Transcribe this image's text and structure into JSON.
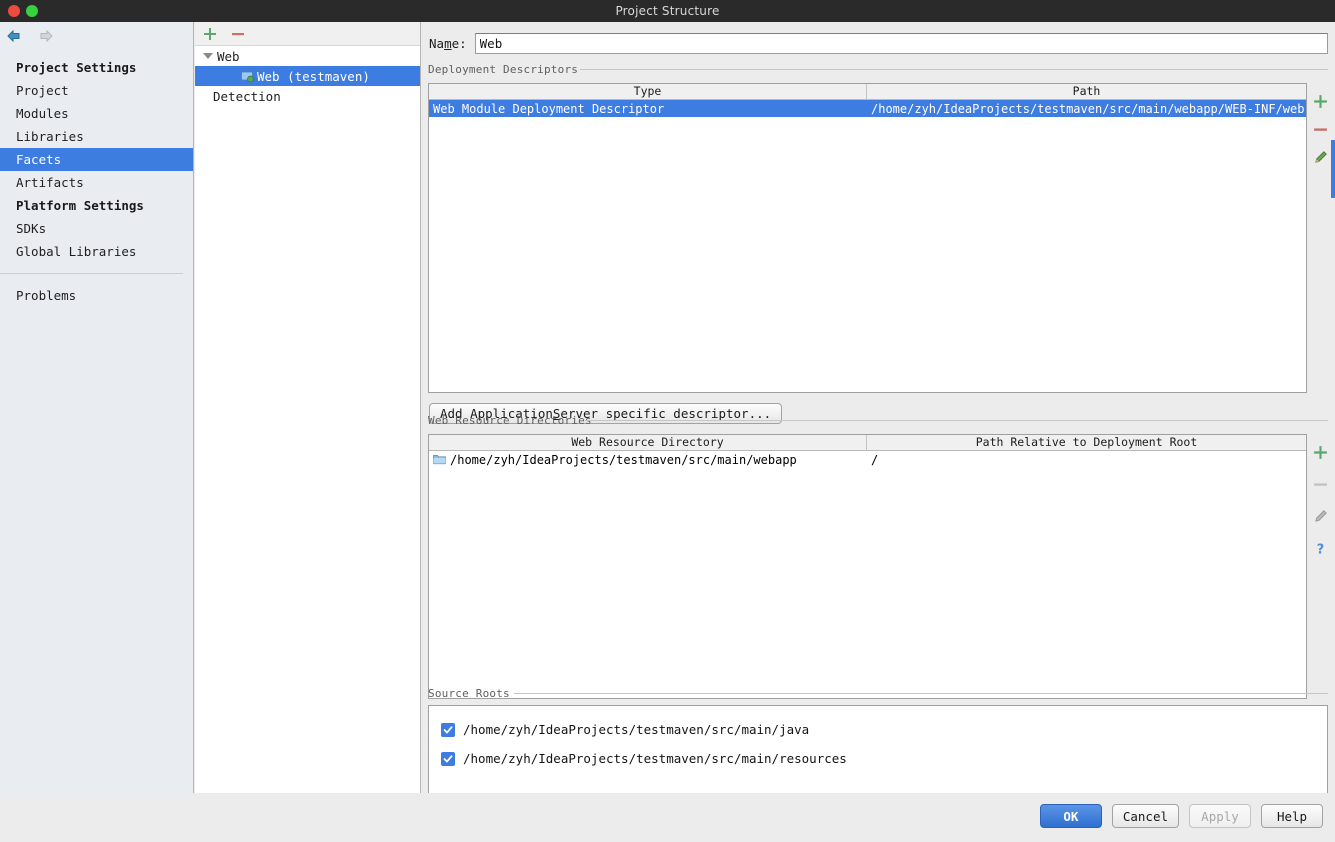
{
  "window": {
    "title": "Project Structure",
    "traffic_lights": [
      "close-red",
      "maximize-green"
    ]
  },
  "nav": {
    "back_icon": "arrow-left-icon",
    "forward_icon": "arrow-right-icon"
  },
  "sidebar": {
    "groups": [
      {
        "label": "Project Settings",
        "items": [
          {
            "label": "Project",
            "selected": false
          },
          {
            "label": "Modules",
            "selected": false
          },
          {
            "label": "Libraries",
            "selected": false
          },
          {
            "label": "Facets",
            "selected": true
          },
          {
            "label": "Artifacts",
            "selected": false
          }
        ]
      },
      {
        "label": "Platform Settings",
        "items": [
          {
            "label": "SDKs",
            "selected": false
          },
          {
            "label": "Global Libraries",
            "selected": false
          }
        ]
      }
    ],
    "footer_item": {
      "label": "Problems",
      "selected": false
    }
  },
  "tree": {
    "toolbar": {
      "add_label": "+",
      "remove_label": "–"
    },
    "nodes": [
      {
        "label": "Web",
        "type": "group",
        "expanded": true,
        "selected": false
      },
      {
        "label": "Web (testmaven)",
        "type": "facet",
        "selected": true
      },
      {
        "label": "Detection",
        "type": "group",
        "selected": false
      }
    ]
  },
  "main": {
    "name_field": {
      "label": "Name:",
      "label_mnemonic": "m",
      "value": "Web"
    },
    "deployment_descriptors": {
      "title": "Deployment Descriptors",
      "columns": [
        "Type",
        "Path"
      ],
      "rows": [
        {
          "type": "Web Module Deployment Descriptor",
          "path": "/home/zyh/IdeaProjects/testmaven/src/main/webapp/WEB-INF/web.xml",
          "selected": true
        }
      ],
      "tools": [
        {
          "name": "add-descriptor-button",
          "icon": "plus-icon",
          "enabled": true
        },
        {
          "name": "remove-descriptor-button",
          "icon": "minus-icon",
          "enabled": true
        },
        {
          "name": "edit-descriptor-button",
          "icon": "pencil-icon",
          "enabled": true
        }
      ],
      "add_server_descriptor_button": {
        "label": "Add Application Server specific descriptor...",
        "mnemonic": "S"
      }
    },
    "web_resource_directories": {
      "title": "Web Resource Directories",
      "columns": [
        "Web Resource Directory",
        "Path Relative to Deployment Root"
      ],
      "rows": [
        {
          "directory": "/home/zyh/IdeaProjects/testmaven/src/main/webapp",
          "relative_path": "/",
          "icon": "folder-icon"
        }
      ],
      "tools": [
        {
          "name": "add-resource-dir-button",
          "icon": "plus-icon",
          "enabled": true
        },
        {
          "name": "remove-resource-dir-button",
          "icon": "minus-icon",
          "enabled": false
        },
        {
          "name": "edit-resource-dir-button",
          "icon": "pencil-icon",
          "enabled": false
        },
        {
          "name": "help-resource-dir-button",
          "icon": "question-icon",
          "enabled": true
        }
      ]
    },
    "source_roots": {
      "title": "Source Roots",
      "items": [
        {
          "label": "/home/zyh/IdeaProjects/testmaven/src/main/java",
          "checked": true
        },
        {
          "label": "/home/zyh/IdeaProjects/testmaven/src/main/resources",
          "checked": true
        }
      ]
    }
  },
  "footer": {
    "buttons": [
      {
        "label": "OK",
        "style": "default",
        "enabled": true
      },
      {
        "label": "Cancel",
        "style": "normal",
        "enabled": true
      },
      {
        "label": "Apply",
        "style": "disabled",
        "enabled": false
      },
      {
        "label": "Help",
        "style": "normal",
        "enabled": true
      }
    ]
  },
  "colors": {
    "selection_blue": "#3d7ce0",
    "titlebar": "#2a2a2a",
    "dialog_bg": "#ececec",
    "sidebar_bg": "#e9edf1",
    "accent_green": "#4caf50",
    "accent_red": "#d46a6a"
  }
}
